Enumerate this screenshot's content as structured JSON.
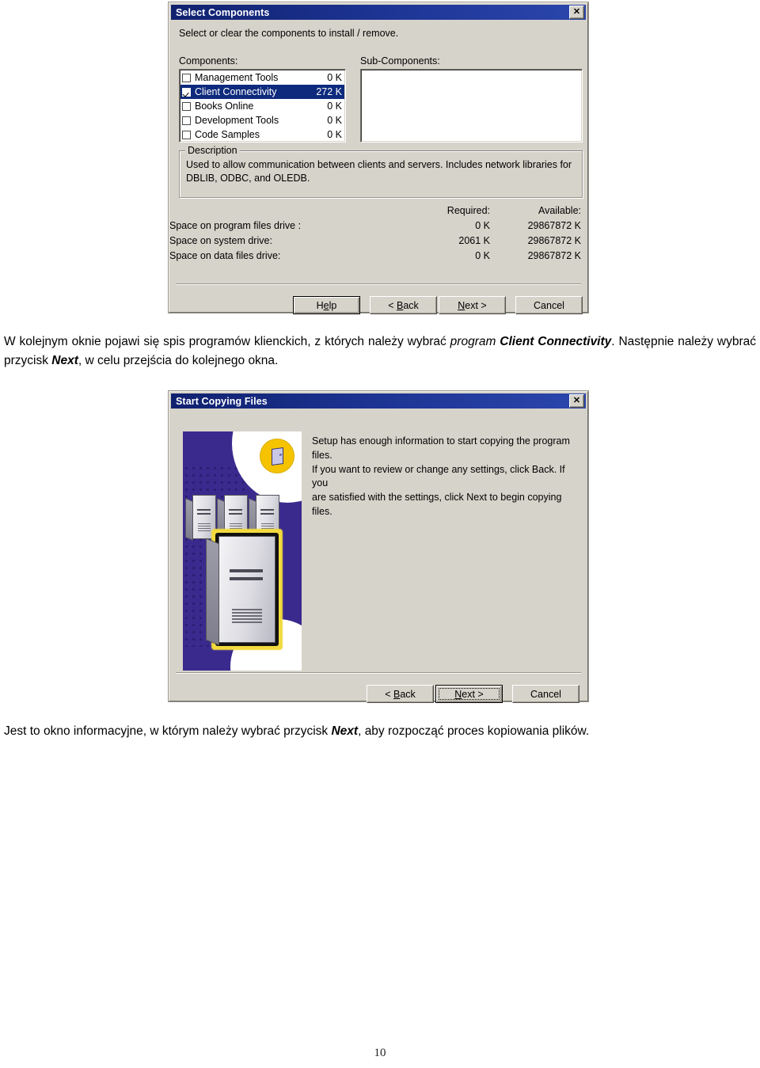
{
  "page": {
    "number": "10"
  },
  "dialog_select_components": {
    "title": "Select Components",
    "close_label": "✕",
    "instruction": "Select or clear the components to install / remove.",
    "components_label": "Components:",
    "subcomponents_label": "Sub-Components:",
    "components": [
      {
        "name": "Management Tools",
        "size": "0 K",
        "checked": false,
        "selected": false
      },
      {
        "name": "Client Connectivity",
        "size": "272 K",
        "checked": true,
        "selected": true
      },
      {
        "name": "Books Online",
        "size": "0 K",
        "checked": false,
        "selected": false
      },
      {
        "name": "Development Tools",
        "size": "0 K",
        "checked": false,
        "selected": false
      },
      {
        "name": "Code Samples",
        "size": "0 K",
        "checked": false,
        "selected": false
      }
    ],
    "subcomponents": [],
    "description_title": "Description",
    "description_text": "Used to allow communication between clients and servers. Includes network libraries for DBLIB, ODBC, and OLEDB.",
    "space_table": {
      "col_required": "Required:",
      "col_available": "Available:",
      "rows": [
        {
          "label": "Space on program files drive :",
          "required": "0 K",
          "available": "29867872 K"
        },
        {
          "label": "Space on system drive:",
          "required": "2061 K",
          "available": "29867872 K"
        },
        {
          "label": "Space on data files drive:",
          "required": "0 K",
          "available": "29867872 K"
        }
      ]
    },
    "buttons": {
      "help": {
        "pre": "H",
        "accel": "e",
        "post": "lp",
        "label": "Help"
      },
      "back": {
        "pre": "< ",
        "accel": "B",
        "post": "ack",
        "label": "< Back"
      },
      "next": {
        "pre": "",
        "accel": "N",
        "post": "ext >",
        "label": "Next >"
      },
      "cancel": {
        "pre": "Cancel",
        "accel": "",
        "post": "",
        "label": "Cancel"
      }
    }
  },
  "caption_1": {
    "run1": "W kolejnym oknie pojawi się spis programów klienckich, z których należy wybrać ",
    "run2_italic": "program ",
    "run3_bold_italic": "Client Connectivity",
    "run4": ". Następnie należy wybrać przycisk ",
    "run5_bold_italic": "Next",
    "run6": ", w celu przejścia do kolejnego okna."
  },
  "dialog_start_copying": {
    "title": "Start Copying Files",
    "close_label": "✕",
    "message": "Setup has enough information to start copying the program files. If you want to review or change any settings, click Back.  If you are satisfied with the settings, click Next to begin copying files.",
    "message_lines": [
      "Setup has enough information to start copying the program files.",
      "If you want to review or change any settings, click Back.  If you",
      "are satisfied with the settings, click Next to begin copying files."
    ],
    "artwork": {
      "name": "sql-server-setup-splash",
      "panel_color": "#3a2a8e",
      "badge_color": "#f5c300",
      "glow_color": "#f2da3d"
    },
    "buttons": {
      "back": {
        "pre": "< ",
        "accel": "B",
        "post": "ack",
        "label": "< Back"
      },
      "next": {
        "pre": "",
        "accel": "N",
        "post": "ext >",
        "label": "Next >"
      },
      "cancel": {
        "pre": "Cancel",
        "accel": "",
        "post": "",
        "label": "Cancel"
      }
    }
  },
  "caption_2": {
    "run1": "Jest to okno informacyjne, w którym należy wybrać przycisk ",
    "run2_bold_italic": "Next",
    "run3": ", aby rozpocząć proces kopiowania plików."
  }
}
